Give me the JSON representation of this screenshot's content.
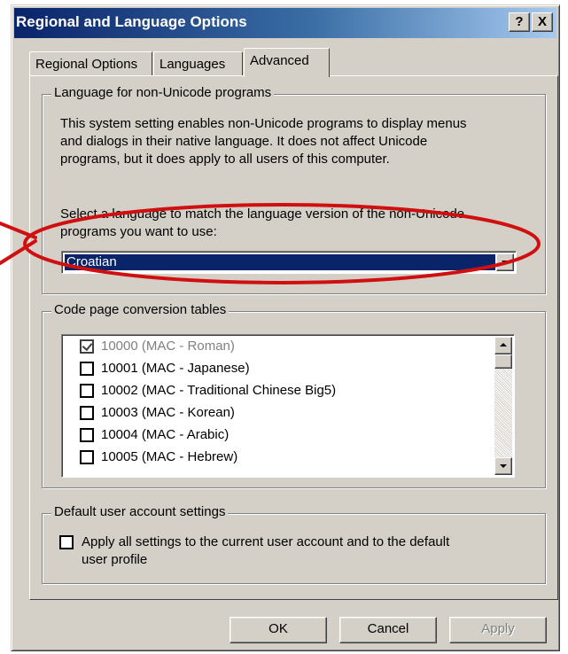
{
  "window": {
    "title": "Regional and Language Options",
    "help_button": "?",
    "close_button": "X"
  },
  "tabs": [
    {
      "label": "Regional Options",
      "active": false
    },
    {
      "label": "Languages",
      "active": false
    },
    {
      "label": "Advanced",
      "active": true
    }
  ],
  "non_unicode": {
    "legend": "Language for non-Unicode programs",
    "description_lines": [
      "This system setting enables non-Unicode programs to display menus",
      "and dialogs in their native language. It does not affect Unicode",
      "programs, but it does apply to all users of this computer."
    ],
    "select_prompt_lines": [
      "Select a language to match the language version of the non-Unicode",
      "programs you want to use:"
    ],
    "selected_language": "Croatian"
  },
  "code_page": {
    "legend": "Code page conversion tables",
    "items": [
      {
        "label": "10000 (MAC - Roman)",
        "checked": true,
        "disabled": true
      },
      {
        "label": "10001 (MAC - Japanese)",
        "checked": false,
        "disabled": false
      },
      {
        "label": "10002 (MAC - Traditional Chinese Big5)",
        "checked": false,
        "disabled": false
      },
      {
        "label": "10003 (MAC - Korean)",
        "checked": false,
        "disabled": false
      },
      {
        "label": "10004 (MAC - Arabic)",
        "checked": false,
        "disabled": false
      },
      {
        "label": "10005 (MAC - Hebrew)",
        "checked": false,
        "disabled": false
      }
    ]
  },
  "default_account": {
    "legend": "Default user account settings",
    "checkbox_label_lines": [
      "Apply all settings to the current user account and to the default",
      "user profile"
    ],
    "checked": false
  },
  "buttons": {
    "ok": "OK",
    "cancel": "Cancel",
    "apply": "Apply"
  },
  "annotation_color": "#d01010"
}
